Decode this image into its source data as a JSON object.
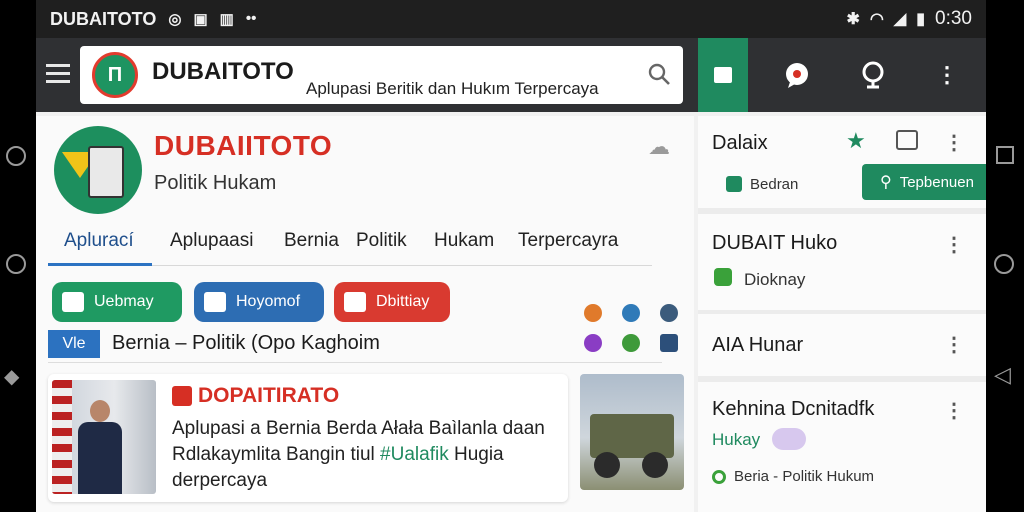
{
  "status_bar": {
    "app_name": "DUBAITOTO",
    "time": "0:30"
  },
  "app_bar": {
    "logo_text": "DUBAITOTO",
    "tagline": "Aplupasi Beritik dan Hukım Terpercaya"
  },
  "profile": {
    "title": "DUBAIITOTO",
    "subtitle": "Politik Hukam"
  },
  "tabs": [
    {
      "label": "Aplurací",
      "active": true
    },
    {
      "label": "Aplupaasi",
      "active": false
    },
    {
      "label": "Bernia",
      "active": false
    },
    {
      "label": "Politik",
      "active": false
    },
    {
      "label": "Hukam",
      "active": false
    },
    {
      "label": "Terpercayra",
      "active": false
    }
  ],
  "chips": [
    {
      "label": "Uebmay",
      "color": "#1f9a62"
    },
    {
      "label": "Hoyomof",
      "color": "#2d6db3"
    },
    {
      "label": "Dbittiay",
      "color": "#d93a30"
    }
  ],
  "headline_bar": {
    "tag": "Vle",
    "text": "Bernia – Politik (Opo Kaghoim"
  },
  "article": {
    "source": "DOPAITIRATO",
    "body_1": "Aplupasi a Bernia Berda Ałała Baìlanla daan Rdlakaymlita Bangin tiul",
    "body_hashtag": "#Ualafik",
    "body_2": "Hugia derpercaya"
  },
  "right_panel": {
    "header": "Dalaix",
    "btn_left": "Bedran",
    "btn_right": "Tepbenuen",
    "items": [
      {
        "title": "DUBAIT Huko",
        "sub": "Dioknay"
      },
      {
        "title": "AIA Hunar",
        "sub": ""
      },
      {
        "title": "Kehnina Dcnitadfk",
        "sub": "Hukay",
        "extra": "Beria - Politik Hukum"
      }
    ]
  },
  "colors": {
    "accent_green": "#1f8a5f",
    "brand_red": "#d62f24",
    "accent_blue": "#2c72c0"
  },
  "icons": [
    "menu-icon",
    "search-icon",
    "bookmark-icon",
    "chat-icon",
    "location-icon",
    "more-vert-icon",
    "cloud-icon",
    "star-icon",
    "fullscreen-icon"
  ]
}
